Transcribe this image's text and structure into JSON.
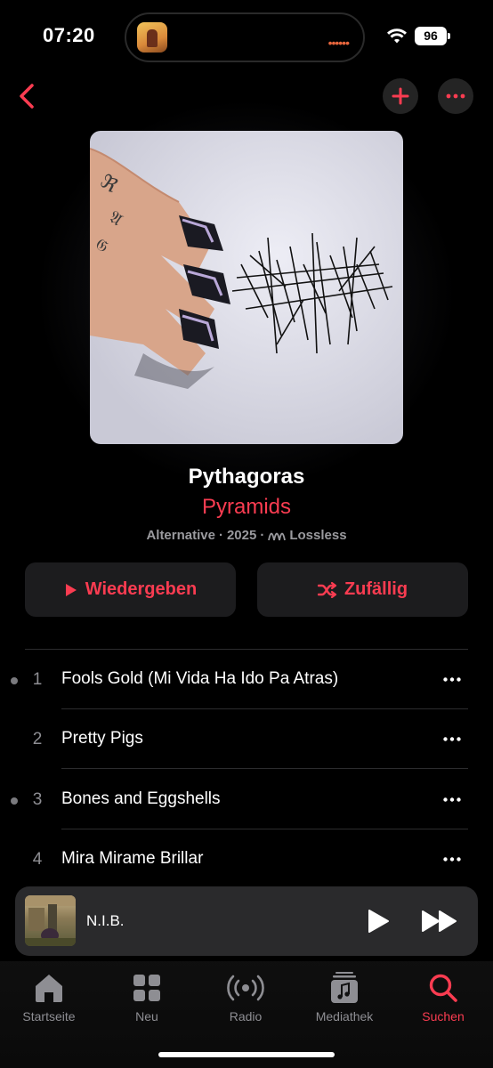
{
  "status_bar": {
    "time": "07:20",
    "battery": "96",
    "icons": [
      "wifi-icon",
      "battery-icon"
    ]
  },
  "nav": {
    "back_icon": "chevron-left-icon",
    "add_icon": "plus-icon",
    "more_icon": "ellipsis-icon"
  },
  "album": {
    "title": "Pythagoras",
    "artist": "Pyramids",
    "genre": "Alternative",
    "year": "2025",
    "quality": "Lossless",
    "separator": "·"
  },
  "actions": {
    "play_label": "Wiedergeben",
    "shuffle_label": "Zufällig"
  },
  "tracks": [
    {
      "number": "1",
      "title": "Fools Gold (Mi Vida Ha Ido Pa Atras)",
      "dot": true
    },
    {
      "number": "2",
      "title": "Pretty Pigs",
      "dot": false
    },
    {
      "number": "3",
      "title": "Bones and Eggshells",
      "dot": true
    },
    {
      "number": "4",
      "title": "Mira Mirame Brillar",
      "dot": false
    }
  ],
  "mini_player": {
    "title": "N.I.B."
  },
  "tabs": [
    {
      "label": "Startseite",
      "icon": "home-icon",
      "active": false
    },
    {
      "label": "Neu",
      "icon": "grid-icon",
      "active": false
    },
    {
      "label": "Radio",
      "icon": "radio-icon",
      "active": false
    },
    {
      "label": "Mediathek",
      "icon": "library-icon",
      "active": false
    },
    {
      "label": "Suchen",
      "icon": "search-icon",
      "active": true
    }
  ],
  "colors": {
    "accent": "#fa3c51",
    "background": "#000000",
    "button_bg": "#1c1c1e"
  }
}
